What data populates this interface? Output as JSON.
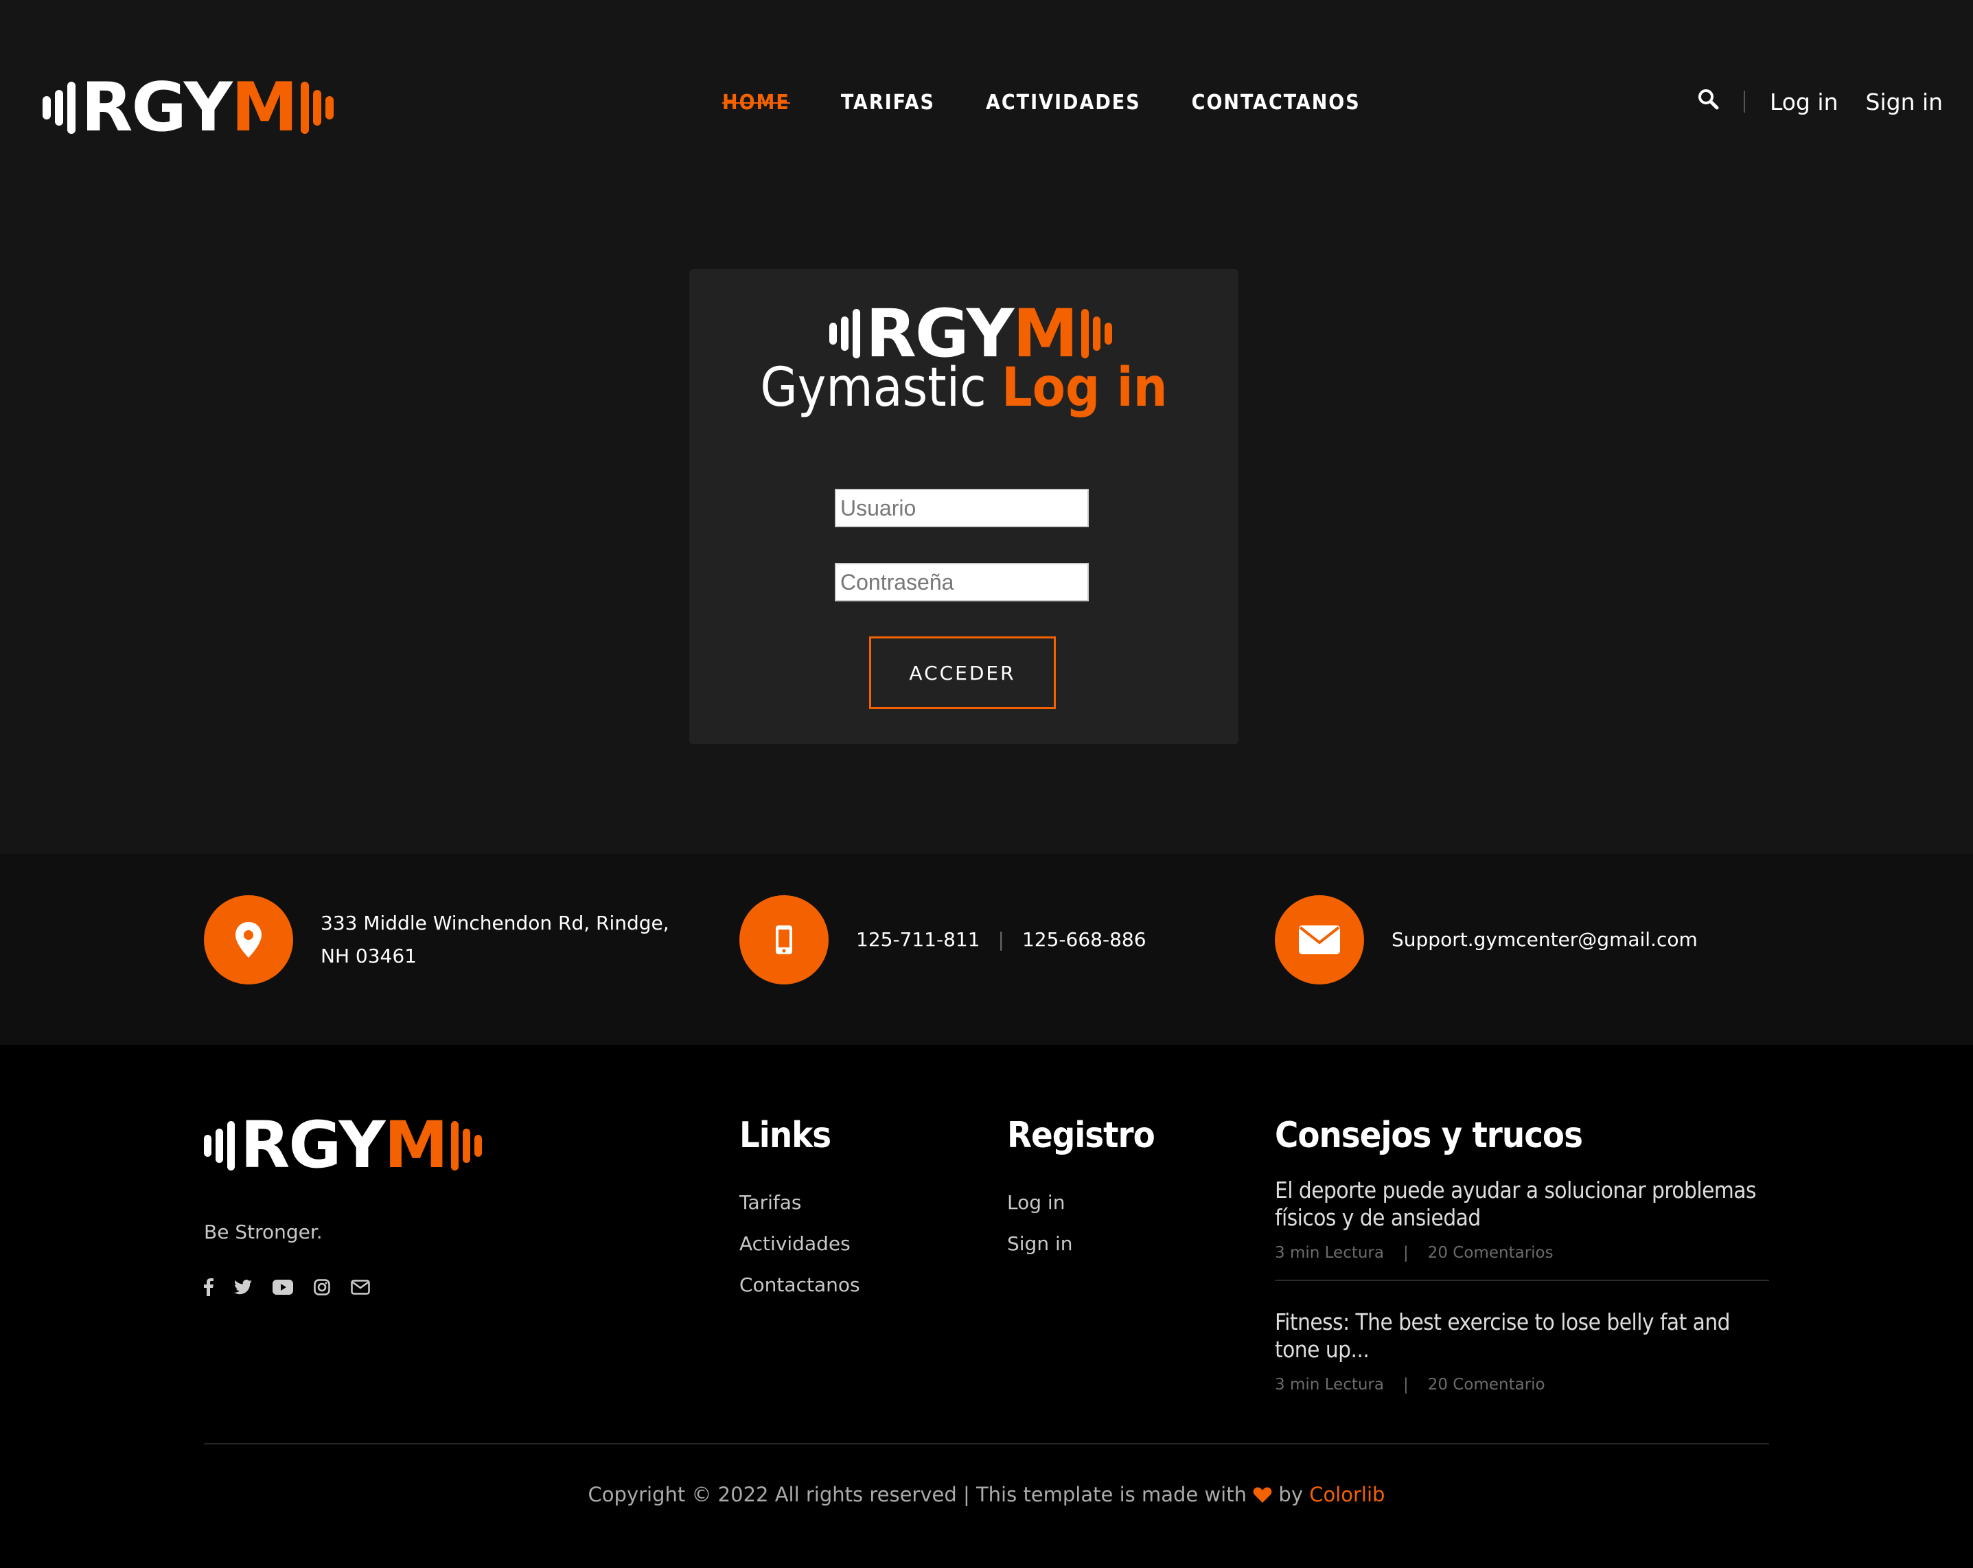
{
  "brand": {
    "logo_left": "RGY",
    "logo_right": "M",
    "accent_color": "#f36100"
  },
  "nav": {
    "items": [
      {
        "label": "HOME",
        "active": true
      },
      {
        "label": "TARIFAS"
      },
      {
        "label": "ACTIVIDADES"
      },
      {
        "label": "CONTACTANOS"
      }
    ]
  },
  "header": {
    "search_icon": "search-icon",
    "login_label": "Log in",
    "signin_label": "Sign in"
  },
  "login": {
    "title_part1": "Gymastic",
    "title_part2": "Log in",
    "username_placeholder": "Usuario",
    "password_placeholder": "Contraseña",
    "submit_label": "ACCEDER"
  },
  "contact": {
    "address_line1": "333 Middle Winchendon Rd, Rindge,",
    "address_line2": "NH 03461",
    "phone1": "125-711-811",
    "phone_separator": "|",
    "phone2": "125-668-886",
    "email": "Support.gymcenter@gmail.com"
  },
  "footer": {
    "tagline": "Be Stronger.",
    "socials": [
      "facebook-icon",
      "twitter-icon",
      "youtube-icon",
      "instagram-icon",
      "mail-icon"
    ],
    "links": {
      "title": "Links",
      "items": [
        "Tarifas",
        "Actividades",
        "Contactanos"
      ]
    },
    "registro": {
      "title": "Registro",
      "items": [
        "Log in",
        "Sign in"
      ]
    },
    "tips": {
      "title": "Consejos y trucos",
      "posts": [
        {
          "title": "El deporte puede ayudar a solucionar problemas físicos y de ansiedad",
          "read": "3 min Lectura",
          "sep": "|",
          "comments": "20 Comentarios"
        },
        {
          "title": "Fitness: The best exercise to lose belly fat and tone up...",
          "read": "3 min Lectura",
          "sep": "|",
          "comments": "20 Comentario"
        }
      ]
    },
    "copyright_prefix": "Copyright © 2022 All rights reserved | This template is made with",
    "copyright_by": "by",
    "copyright_brand": "Colorlib"
  }
}
